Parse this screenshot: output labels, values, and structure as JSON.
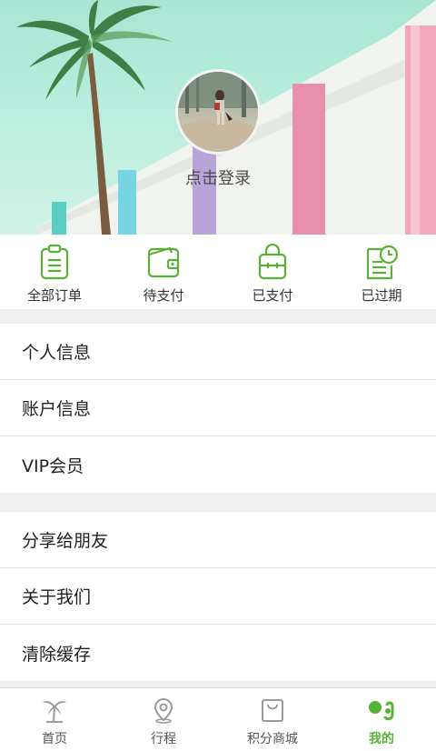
{
  "header": {
    "login_text": "点击登录",
    "avatar_alt": "avatar"
  },
  "orders": [
    {
      "label": "全部订单",
      "icon": "clipboard-icon"
    },
    {
      "label": "待支付",
      "icon": "wallet-icon"
    },
    {
      "label": "已支付",
      "icon": "bag-icon"
    },
    {
      "label": "已过期",
      "icon": "document-clock-icon"
    }
  ],
  "menu_group_1": [
    {
      "label": "个人信息"
    },
    {
      "label": "账户信息"
    },
    {
      "label": "VIP会员"
    }
  ],
  "menu_group_2": [
    {
      "label": "分享给朋友"
    },
    {
      "label": "关于我们"
    },
    {
      "label": "清除缓存"
    }
  ],
  "tabbar": {
    "items": [
      {
        "label": "首页",
        "icon": "palm-tree-icon",
        "active": false
      },
      {
        "label": "行程",
        "icon": "location-pin-icon",
        "active": false
      },
      {
        "label": "积分商城",
        "icon": "shopping-bag-icon",
        "active": false
      },
      {
        "label": "我的",
        "icon": "profile-icon",
        "active": true
      }
    ]
  },
  "colors": {
    "accent_green": "#58b034",
    "hero_sky": "#a7e6d3",
    "background": "#efefef"
  }
}
